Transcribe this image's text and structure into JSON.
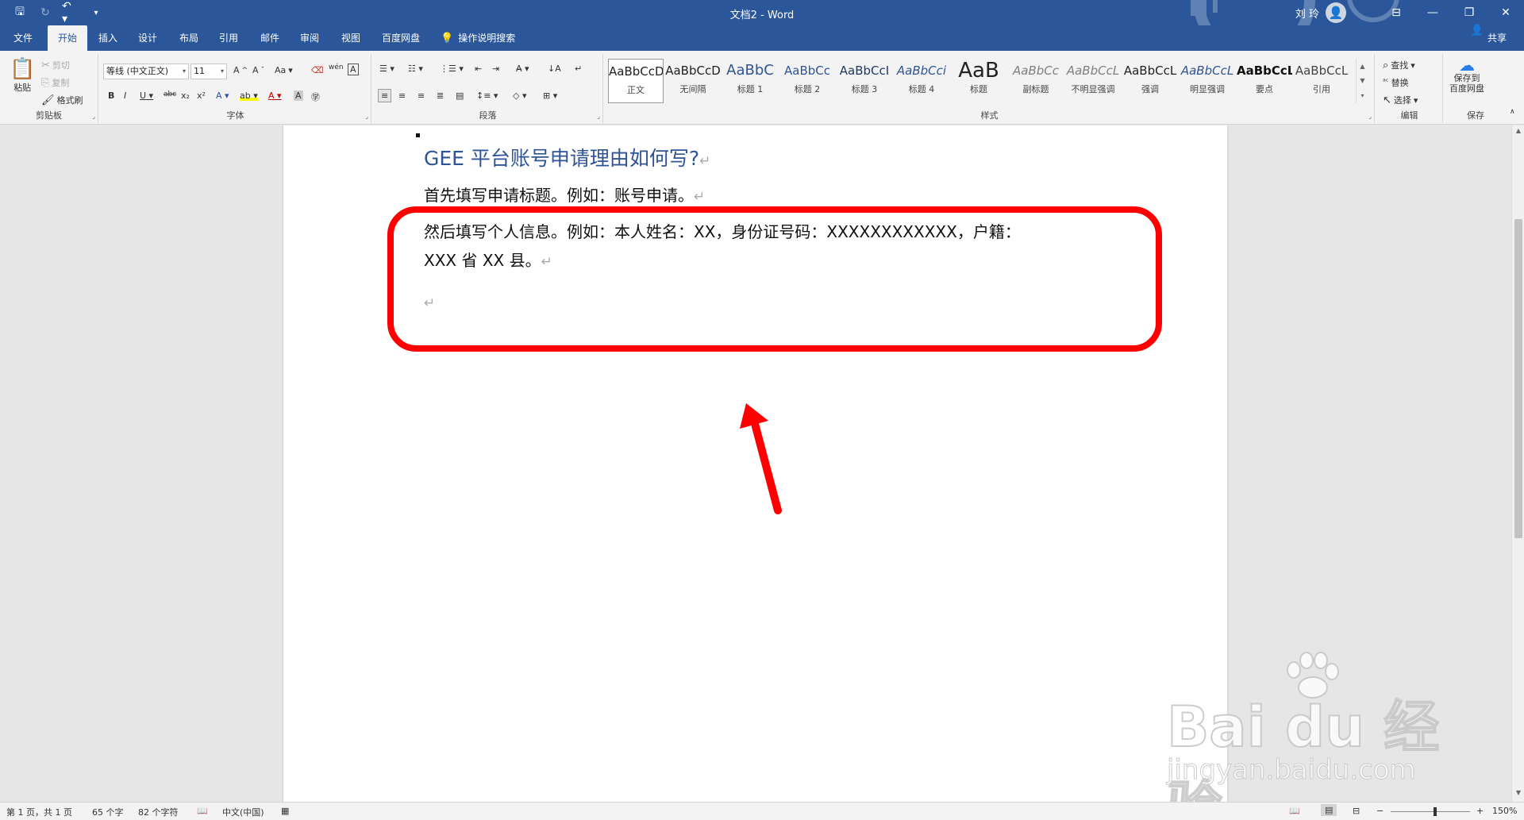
{
  "window": {
    "title": "文档2 - Word",
    "user_name": "刘 玲"
  },
  "tabs": [
    {
      "label": "文件"
    },
    {
      "label": "开始"
    },
    {
      "label": "插入"
    },
    {
      "label": "设计"
    },
    {
      "label": "布局"
    },
    {
      "label": "引用"
    },
    {
      "label": "邮件"
    },
    {
      "label": "审阅"
    },
    {
      "label": "视图"
    },
    {
      "label": "百度网盘"
    }
  ],
  "tell_me": "操作说明搜索",
  "share": "共享",
  "ribbon": {
    "clipboard": {
      "label": "剪贴板",
      "paste": "粘贴",
      "cut": "剪切",
      "copy": "复制",
      "format_painter": "格式刷"
    },
    "font": {
      "label": "字体",
      "font_name": "等线 (中文正文)",
      "font_size": "11",
      "change_case": "Aa"
    },
    "paragraph": {
      "label": "段落"
    },
    "styles": {
      "label": "样式",
      "items": [
        {
          "sample": "AaBbCcD",
          "name": "正文",
          "color": "#222222"
        },
        {
          "sample": "AaBbCcD",
          "name": "无间隔",
          "color": "#222222"
        },
        {
          "sample": "AaBbC",
          "name": "标题 1",
          "color": "#2f5496"
        },
        {
          "sample": "AaBbCc",
          "name": "标题 2",
          "color": "#2f5496"
        },
        {
          "sample": "AaBbCcI",
          "name": "标题 3",
          "color": "#1f3864"
        },
        {
          "sample": "AaBbCci",
          "name": "标题 4",
          "color": "#2f5496"
        },
        {
          "sample": "AaB",
          "name": "标题",
          "color": "#222222"
        },
        {
          "sample": "AaBbCc",
          "name": "副标题",
          "color": "#7f7f7f"
        },
        {
          "sample": "AaBbCcL",
          "name": "不明显强调",
          "color": "#7f7f7f"
        },
        {
          "sample": "AaBbCcL",
          "name": "强调",
          "color": "#222222"
        },
        {
          "sample": "AaBbCcL",
          "name": "明显强调",
          "color": "#2f5496"
        },
        {
          "sample": "AaBbCcL",
          "name": "要点",
          "color": "#111111"
        },
        {
          "sample": "AaBbCcL",
          "name": "引用",
          "color": "#444444"
        }
      ]
    },
    "editing": {
      "label": "编辑",
      "find": "查找",
      "replace": "替换",
      "select": "选择"
    },
    "save": {
      "label": "保存",
      "save_to_baidu_line1": "保存到",
      "save_to_baidu_line2": "百度网盘"
    }
  },
  "document": {
    "heading": "GEE 平台账号申请理由如何写?",
    "paragraph1": "首先填写申请标题。例如：账号申请。",
    "paragraph2_line1": "然后填写个人信息。例如：本人姓名：XX，身份证号码：XXXXXXXXXXXX，户籍：",
    "paragraph2_line2": "XXX 省 XX 县。",
    "return_mark": "↵"
  },
  "watermark": {
    "brand": "Bai du 经验",
    "url": "jingyan.baidu.com"
  },
  "status_bar": {
    "page": "第 1 页，共 1 页",
    "words": "65 个字",
    "chars": "82 个字符",
    "language": "中文(中国)",
    "zoom": "150%"
  },
  "colors": {
    "accent": "#2b579a",
    "annotation": "#ff0000",
    "heading": "#2f5496"
  }
}
